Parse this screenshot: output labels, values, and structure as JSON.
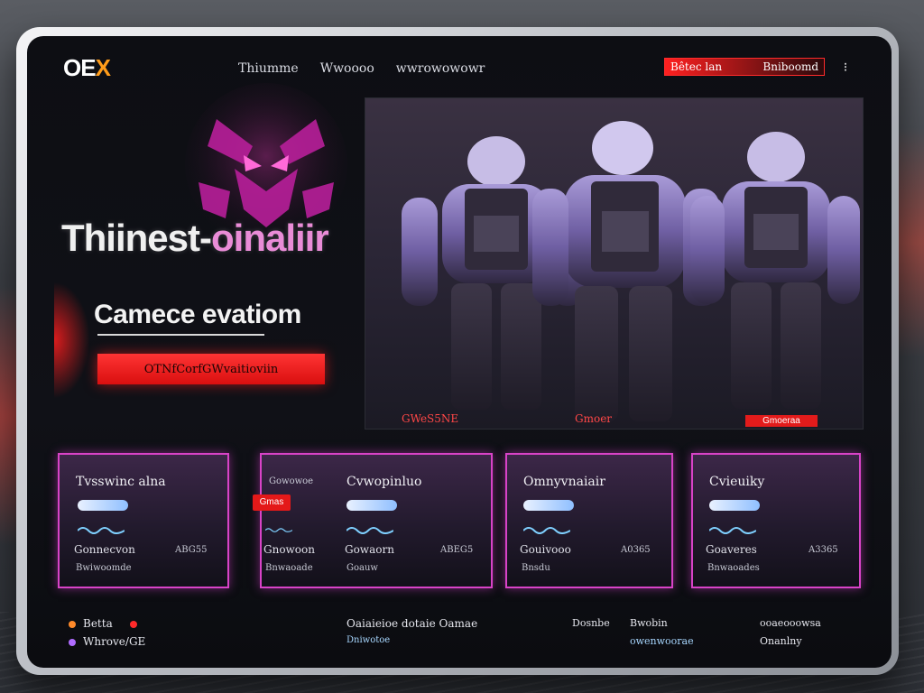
{
  "header": {
    "logo_main": "OE",
    "logo_accent": "X",
    "nav": [
      "Thiumme",
      "Wwoooo",
      "wwrowowowr"
    ],
    "signin_left": "Bêtec lan",
    "signin_right": "Bniboomd",
    "menu_icon": "kebab-menu-icon"
  },
  "hero": {
    "title_main": "Thiinest-",
    "title_accent": "oinaliir",
    "subtitle": "Camece evatiom",
    "cta_label": "OTNfCorfGWvaitioviin",
    "emblem_icon": "demon-mask-emblem"
  },
  "media": {
    "label_left": "GWeS5NE",
    "label_mid": "Gmoer",
    "badge": "Gmoeraa",
    "accent": "#e21b1b"
  },
  "cards": [
    {
      "title": "Tvsswinc alna",
      "row1_left": "Gonnecvon",
      "row1_right": "ABG55",
      "row2": "Bwiwoomde"
    },
    {
      "tag": "Gmas",
      "title_left": "Gowowoe",
      "title": "Cvwopinluo",
      "row1_left": "Gnowoon",
      "row1_mid": "Gowaorn",
      "row1_right": "ABEG5",
      "row2_left": "Bnwaoade",
      "row2_right": "Goauw"
    },
    {
      "title": "Omnyvnaiair",
      "row1_left": "Gouivooo",
      "row1_right": "A0365",
      "row2": "Bnsdu"
    },
    {
      "title": "Cvieuiky",
      "row1_left": "Goaveres",
      "row1_right": "A3365",
      "row2": "Bnwaoades"
    }
  ],
  "footer": {
    "left_top": "Betta",
    "left_bottom": "Whrove/GE",
    "center_title": "Oaiaieioe dotaie Oamae",
    "center_link": "Dniwotoe",
    "col1": "Dosnbe",
    "col2_top": "Bwobin",
    "col2_bottom": "owenwoorae",
    "col3_top": "ooaeooowsa",
    "col3_bottom": "Onanlny"
  }
}
